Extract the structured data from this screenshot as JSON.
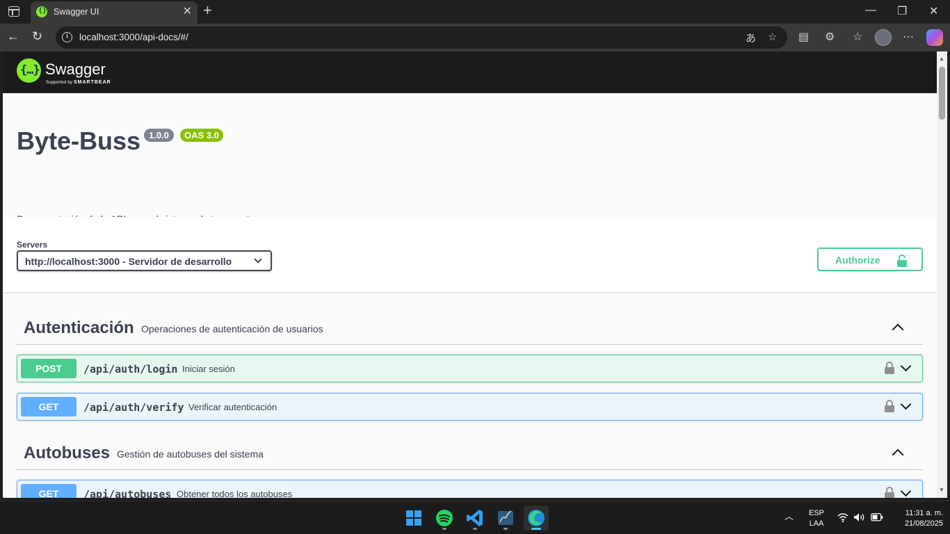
{
  "browser": {
    "tab_title": "Swagger UI",
    "url": "localhost:3000/api-docs/#/"
  },
  "swagger": {
    "brand": "Swagger",
    "supported_by": "Supported by",
    "smartbear": "SMARTBEAR",
    "title": "Byte-Buss",
    "version": "1.0.0",
    "oas": "OAS 3.0",
    "description": "Documentación de la API para el sistema de transporte",
    "servers_label": "Servers",
    "server_selected": "http://localhost:3000 - Servidor de desarrollo",
    "authorize_label": "Authorize"
  },
  "tags": [
    {
      "name": "Autenticación",
      "description": "Operaciones de autenticación de usuarios",
      "operations": [
        {
          "method": "POST",
          "path": "/api/auth/login",
          "summary": "Iniciar sesión"
        },
        {
          "method": "GET",
          "path": "/api/auth/verify",
          "summary": "Verificar autenticación"
        }
      ]
    },
    {
      "name": "Autobuses",
      "description": "Gestión de autobuses del sistema",
      "operations": [
        {
          "method": "GET",
          "path": "/api/autobuses",
          "summary": "Obtener todos los autobuses"
        }
      ]
    }
  ],
  "taskbar": {
    "lang": "ESP",
    "layout": "LAA",
    "time": "11:31 a. m.",
    "date": "21/08/2025"
  },
  "colors": {
    "post": "#49cc90",
    "get": "#61affe",
    "swagger_green": "#85ea2d",
    "topbar": "#1b1b1b"
  }
}
